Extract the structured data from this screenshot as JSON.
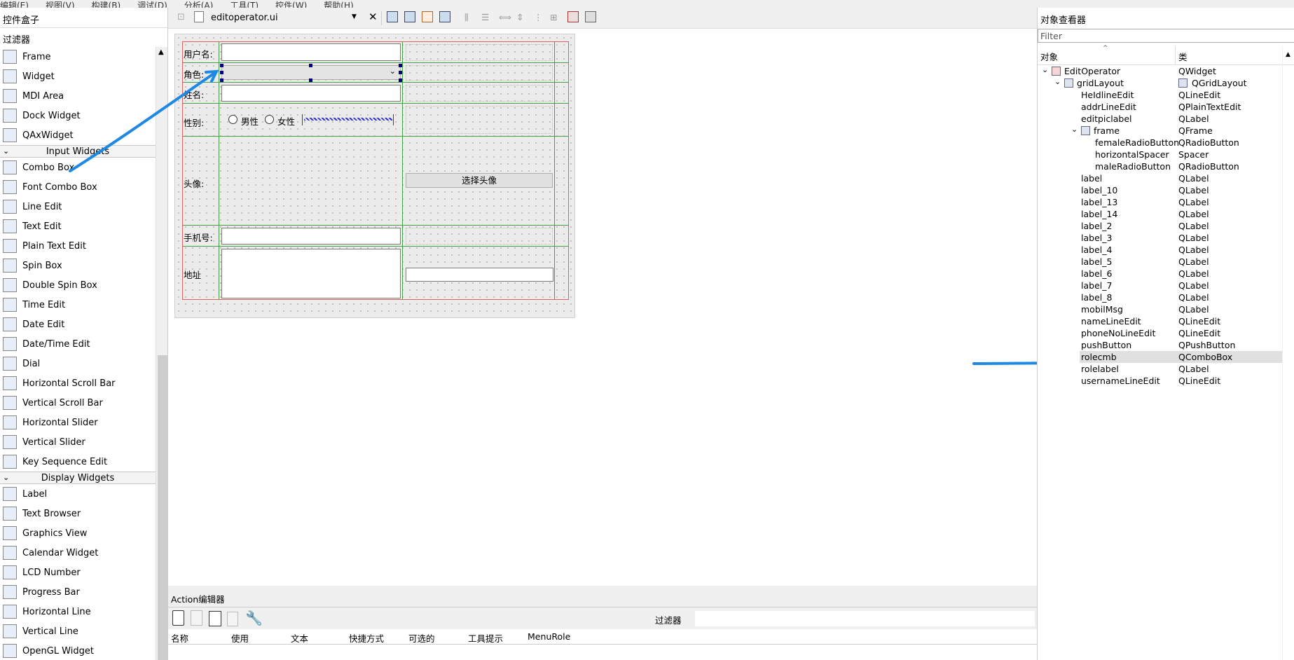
{
  "menubar": [
    "编辑(E)",
    "视图(V)",
    "构建(B)",
    "调试(D)",
    "分析(A)",
    "工具(T)",
    "控件(W)",
    "帮助(H)"
  ],
  "widgetbox": {
    "title": "控件盒子",
    "filter": "过滤器",
    "items": [
      {
        "label": "Frame",
        "icon": "frame-icon"
      },
      {
        "label": "Widget",
        "icon": "widget-icon"
      },
      {
        "label": "MDI Area",
        "icon": "mdi-area-icon"
      },
      {
        "label": "Dock Widget",
        "icon": "dock-widget-icon"
      },
      {
        "label": "QAxWidget",
        "icon": "qax-widget-icon"
      },
      {
        "category": "Input Widgets"
      },
      {
        "label": "Combo Box",
        "icon": "combo-box-icon"
      },
      {
        "label": "Font Combo Box",
        "icon": "font-combo-box-icon"
      },
      {
        "label": "Line Edit",
        "icon": "line-edit-icon"
      },
      {
        "label": "Text Edit",
        "icon": "text-edit-icon"
      },
      {
        "label": "Plain Text Edit",
        "icon": "plain-text-edit-icon"
      },
      {
        "label": "Spin Box",
        "icon": "spin-box-icon"
      },
      {
        "label": "Double Spin Box",
        "icon": "double-spin-box-icon"
      },
      {
        "label": "Time Edit",
        "icon": "time-edit-icon"
      },
      {
        "label": "Date Edit",
        "icon": "date-edit-icon"
      },
      {
        "label": "Date/Time Edit",
        "icon": "date-time-edit-icon"
      },
      {
        "label": "Dial",
        "icon": "dial-icon"
      },
      {
        "label": "Horizontal Scroll Bar",
        "icon": "horizontal-scroll-bar-icon"
      },
      {
        "label": "Vertical Scroll Bar",
        "icon": "vertical-scroll-bar-icon"
      },
      {
        "label": "Horizontal Slider",
        "icon": "horizontal-slider-icon"
      },
      {
        "label": "Vertical Slider",
        "icon": "vertical-slider-icon"
      },
      {
        "label": "Key Sequence Edit",
        "icon": "key-sequence-edit-icon"
      },
      {
        "category": "Display Widgets"
      },
      {
        "label": "Label",
        "icon": "label-icon"
      },
      {
        "label": "Text Browser",
        "icon": "text-browser-icon"
      },
      {
        "label": "Graphics View",
        "icon": "graphics-view-icon"
      },
      {
        "label": "Calendar Widget",
        "icon": "calendar-widget-icon"
      },
      {
        "label": "LCD Number",
        "icon": "lcd-number-icon"
      },
      {
        "label": "Progress Bar",
        "icon": "progress-bar-icon"
      },
      {
        "label": "Horizontal Line",
        "icon": "horizontal-line-icon"
      },
      {
        "label": "Vertical Line",
        "icon": "vertical-line-icon"
      },
      {
        "label": "OpenGL Widget",
        "icon": "opengl-widget-icon"
      }
    ]
  },
  "editor": {
    "filename": "editoperator.ui",
    "form": {
      "username_label": "用户名:",
      "role_label": "角色:",
      "name_label": "姓名:",
      "gender_label": "性别:",
      "male": "男性",
      "female": "女性",
      "avatar_label": "头像:",
      "choose_avatar": "选择头像",
      "phone_label": "手机号:",
      "address_label": "地址"
    }
  },
  "action_editor": {
    "title": "Action编辑器",
    "filter": "过滤器",
    "columns": [
      "名称",
      "使用",
      "文本",
      "快捷方式",
      "可选的",
      "工具提示",
      "MenuRole"
    ]
  },
  "inspector": {
    "title": "对象查看器",
    "filter_placeholder": "Filter",
    "col_object": "对象",
    "col_class": "类",
    "rows": [
      {
        "obj": "EditOperator",
        "cls": "QWidget",
        "depth": 0
      },
      {
        "obj": "gridLayout",
        "cls": "QGridLayout",
        "depth": 1
      },
      {
        "obj": "HeIdlineEdit",
        "cls": "QLineEdit",
        "depth": 2
      },
      {
        "obj": "addrLineEdit",
        "cls": "QPlainTextEdit",
        "depth": 2
      },
      {
        "obj": "editpiclabel",
        "cls": "QLabel",
        "depth": 2
      },
      {
        "obj": "frame",
        "cls": "QFrame",
        "depth": 2
      },
      {
        "obj": "femaleRadioButton",
        "cls": "QRadioButton",
        "depth": 3
      },
      {
        "obj": "horizontalSpacer",
        "cls": "Spacer",
        "depth": 3
      },
      {
        "obj": "maleRadioButton",
        "cls": "QRadioButton",
        "depth": 3
      },
      {
        "obj": "label",
        "cls": "QLabel",
        "depth": 2
      },
      {
        "obj": "label_10",
        "cls": "QLabel",
        "depth": 2
      },
      {
        "obj": "label_13",
        "cls": "QLabel",
        "depth": 2
      },
      {
        "obj": "label_14",
        "cls": "QLabel",
        "depth": 2
      },
      {
        "obj": "label_2",
        "cls": "QLabel",
        "depth": 2
      },
      {
        "obj": "label_3",
        "cls": "QLabel",
        "depth": 2
      },
      {
        "obj": "label_4",
        "cls": "QLabel",
        "depth": 2
      },
      {
        "obj": "label_5",
        "cls": "QLabel",
        "depth": 2
      },
      {
        "obj": "label_6",
        "cls": "QLabel",
        "depth": 2
      },
      {
        "obj": "label_7",
        "cls": "QLabel",
        "depth": 2
      },
      {
        "obj": "label_8",
        "cls": "QLabel",
        "depth": 2
      },
      {
        "obj": "mobilMsg",
        "cls": "QLabel",
        "depth": 2
      },
      {
        "obj": "nameLineEdit",
        "cls": "QLineEdit",
        "depth": 2
      },
      {
        "obj": "phoneNoLineEdit",
        "cls": "QLineEdit",
        "depth": 2
      },
      {
        "obj": "pushButton",
        "cls": "QPushButton",
        "depth": 2
      },
      {
        "obj": "rolecmb",
        "cls": "QComboBox",
        "depth": 2,
        "selected": true
      },
      {
        "obj": "rolelabel",
        "cls": "QLabel",
        "depth": 2
      },
      {
        "obj": "usernameLineEdit",
        "cls": "QLineEdit",
        "depth": 2
      }
    ]
  },
  "colors": {
    "accent": "#1e88e5",
    "selection": "#e0e0e0",
    "grid": "#44a044",
    "layout": "#e06060"
  }
}
